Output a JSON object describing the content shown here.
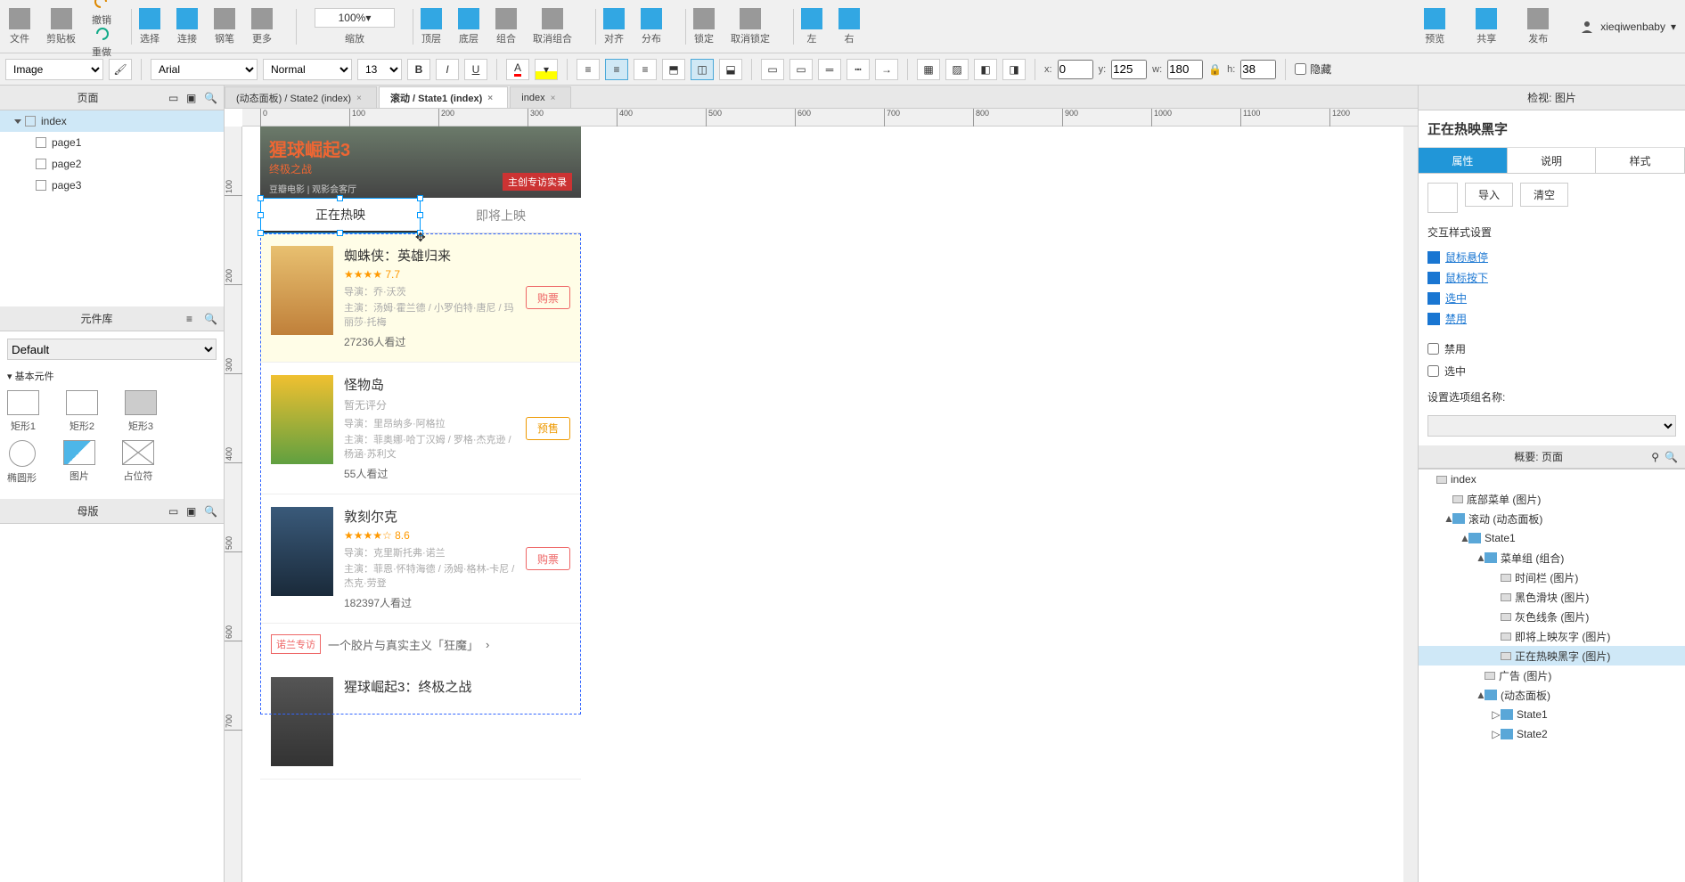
{
  "toolbar1": {
    "file": "文件",
    "clipboard": "剪贴板",
    "undo": "撤销",
    "redo": "重做",
    "select": "选择",
    "connect": "连接",
    "pen": "钢笔",
    "more": "更多",
    "zoom": "100%",
    "zoom_label": "缩放",
    "front": "顶层",
    "back": "底层",
    "group": "组合",
    "ungroup": "取消组合",
    "align": "对齐",
    "distribute": "分布",
    "lock": "锁定",
    "unlock": "取消锁定",
    "left": "左",
    "right": "右",
    "preview": "预览",
    "share": "共享",
    "publish": "发布",
    "user": "xieqiwenbaby"
  },
  "toolbar2": {
    "widget": "Image",
    "font": "Arial",
    "weight": "Normal",
    "size": "13",
    "bold": "B",
    "italic": "I",
    "underline": "U",
    "x_label": "x:",
    "x": "0",
    "y_label": "y:",
    "y": "125",
    "w_label": "w:",
    "w": "180",
    "h_label": "h:",
    "h": "38",
    "hidden": "隐藏"
  },
  "left": {
    "pages_title": "页面",
    "pages": [
      "index",
      "page1",
      "page2",
      "page3"
    ],
    "widgets_title": "元件库",
    "widget_lib": "Default",
    "basic": "基本元件",
    "shapes": [
      "矩形1",
      "矩形2",
      "矩形3",
      "椭圆形",
      "图片",
      "占位符"
    ],
    "masters_title": "母版"
  },
  "tabs": [
    {
      "label": "(动态面板) / State2 (index)",
      "active": false
    },
    {
      "label": "滚动 / State1 (index)",
      "active": true
    },
    {
      "label": "index",
      "active": false
    }
  ],
  "ruler_h": [
    "0",
    "100",
    "200",
    "300",
    "400",
    "500",
    "600",
    "700",
    "800",
    "900",
    "1000",
    "1100",
    "1200"
  ],
  "ruler_v": [
    "100",
    "200",
    "300",
    "400",
    "500",
    "600",
    "700"
  ],
  "mock": {
    "banner_title": "猩球崛起3",
    "banner_sub": "终极之战",
    "banner_meta": "豆瓣电影 | 观影会客厅",
    "banner_tag": "主创专访实录",
    "tab1": "正在热映",
    "tab2": "即将上映",
    "movies": [
      {
        "title": "蜘蛛侠：英雄归来",
        "rating": "★★★★  7.7",
        "dir": "导演：乔·沃茨",
        "cast": "主演：汤姆·霍兰德 / 小罗伯特·唐尼 / 玛丽莎·托梅",
        "views": "27236人看过",
        "btn": "购票"
      },
      {
        "title": "怪物岛",
        "rating": "暂无评分",
        "dir": "导演：里昂纳多·阿格拉",
        "cast": "主演：菲奥娜·哈丁汉姆 / 罗格·杰克逊 / 杨涵·苏利文",
        "views": "55人看过",
        "btn": "预售"
      },
      {
        "title": "敦刻尔克",
        "rating": "★★★★☆  8.6",
        "dir": "导演：克里斯托弗·诺兰",
        "cast": "主演：菲恩·怀特海德 / 汤姆·格林-卡尼 / 杰克·劳登",
        "views": "182397人看过",
        "btn": "购票"
      }
    ],
    "interview_tag": "诺兰专访",
    "interview_text": "一个胶片与真实主义「狂魔」",
    "movie4_title": "猩球崛起3：终极之战"
  },
  "right": {
    "inspect_title": "检视: 图片",
    "name": "正在热映黑字",
    "tab_prop": "属性",
    "tab_desc": "说明",
    "tab_style": "样式",
    "import": "导入",
    "clear": "清空",
    "ix_title": "交互样式设置",
    "ix_hover": "鼠标悬停",
    "ix_down": "鼠标按下",
    "ix_selected": "选中",
    "ix_disabled": "禁用",
    "chk_disabled": "禁用",
    "chk_selected": "选中",
    "group_label": "设置选项组名称:",
    "outline_title": "概要: 页面",
    "outline": [
      {
        "depth": 0,
        "arrow": "",
        "icon": "img",
        "label": "index"
      },
      {
        "depth": 1,
        "arrow": "",
        "icon": "img",
        "label": "底部菜单 (图片)"
      },
      {
        "depth": 1,
        "arrow": "▲",
        "icon": "folder",
        "label": "滚动 (动态面板)"
      },
      {
        "depth": 2,
        "arrow": "▲",
        "icon": "folder",
        "label": "State1"
      },
      {
        "depth": 3,
        "arrow": "▲",
        "icon": "folder",
        "label": "菜单组 (组合)"
      },
      {
        "depth": 4,
        "arrow": "",
        "icon": "img",
        "label": "时间栏 (图片)"
      },
      {
        "depth": 4,
        "arrow": "",
        "icon": "img",
        "label": "黑色滑块 (图片)"
      },
      {
        "depth": 4,
        "arrow": "",
        "icon": "img",
        "label": "灰色线条 (图片)"
      },
      {
        "depth": 4,
        "arrow": "",
        "icon": "img",
        "label": "即将上映灰字 (图片)"
      },
      {
        "depth": 4,
        "arrow": "",
        "icon": "img",
        "label": "正在热映黑字 (图片)",
        "selected": true
      },
      {
        "depth": 3,
        "arrow": "",
        "icon": "img",
        "label": "广告 (图片)"
      },
      {
        "depth": 3,
        "arrow": "▲",
        "icon": "folder",
        "label": "(动态面板)"
      },
      {
        "depth": 4,
        "arrow": "▷",
        "icon": "folder",
        "label": "State1"
      },
      {
        "depth": 4,
        "arrow": "▷",
        "icon": "folder",
        "label": "State2"
      }
    ]
  }
}
